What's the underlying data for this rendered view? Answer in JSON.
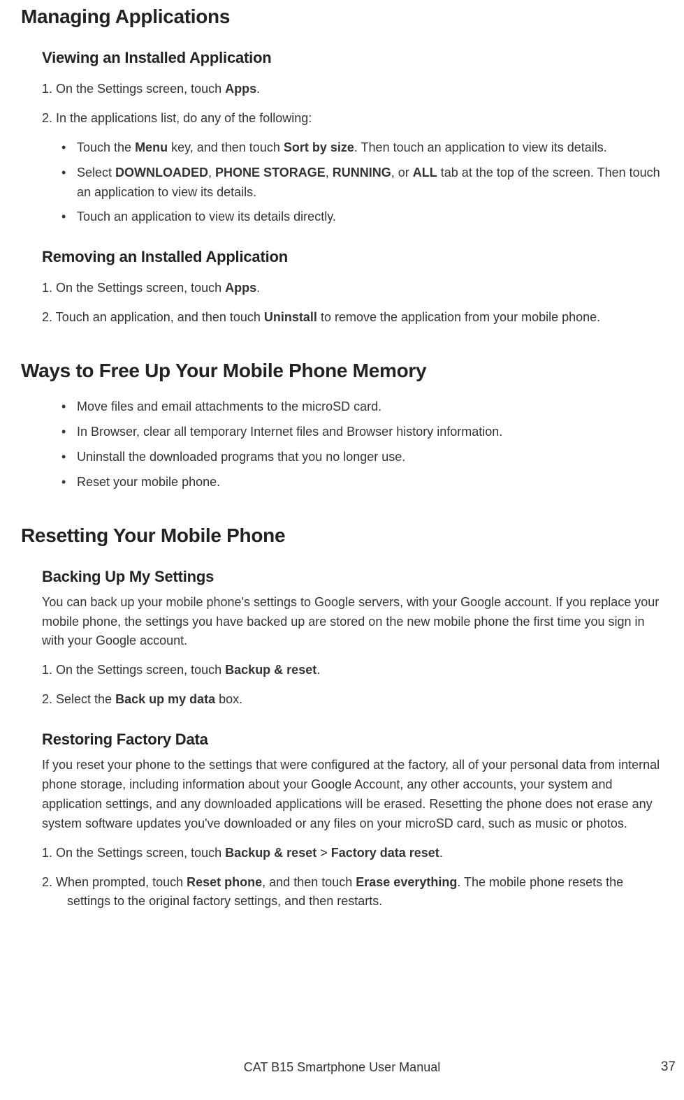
{
  "h1_managing": "Managing Applications",
  "section_viewing": {
    "heading": "Viewing an Installed Application",
    "step1_a": "1. On the Settings screen, touch ",
    "step1_b": "Apps",
    "step1_c": ".",
    "step2": "2. In the applications list, do any of the following:",
    "bullets": [
      {
        "a": "Touch the ",
        "b1": "Menu",
        "c": " key, and then touch ",
        "b2": "Sort by size",
        "d": ". Then touch an application to view its details."
      },
      {
        "a": "Select ",
        "b1": "DOWNLOADED",
        "c": ", ",
        "b2": "PHONE STORAGE",
        "d": ", ",
        "b3": "RUNNING",
        "e": ", or ",
        "b4": "ALL",
        "f": " tab at the top of the screen. Then touch an application to view its details."
      },
      {
        "a": "Touch an application to view its details directly."
      }
    ]
  },
  "section_removing": {
    "heading": "Removing an Installed Application",
    "step1_a": "1. On the Settings screen, touch ",
    "step1_b": "Apps",
    "step1_c": ".",
    "step2_a": "2. Touch an application, and then touch ",
    "step2_b": "Uninstall",
    "step2_c": " to remove the application from your mobile phone."
  },
  "h1_ways": "Ways to Free Up Your Mobile Phone Memory",
  "ways_bullets": [
    "Move files and email attachments to the microSD card.",
    "In Browser, clear all temporary Internet files and Browser history information.",
    "Uninstall the downloaded programs that you no longer use.",
    "Reset your mobile phone."
  ],
  "h1_reset": "Resetting Your Mobile Phone",
  "section_backup": {
    "heading": "Backing Up My Settings",
    "para": "You can back up your mobile phone's settings to Google servers, with your Google account. If you replace your mobile phone, the settings you have backed up are stored on the new mobile phone the first time you sign in with your Google account.",
    "step1_a": "1. On the Settings screen, touch ",
    "step1_b": "Backup & reset",
    "step1_c": ".",
    "step2_a": "2. Select the ",
    "step2_b": "Back up my data",
    "step2_c": " box."
  },
  "section_restore": {
    "heading": "Restoring Factory Data",
    "para": "If you reset your phone to the settings that were configured at the factory, all of your personal data from internal phone storage, including information about your Google Account, any other accounts, your system and application settings, and any downloaded applications will be erased. Resetting the phone does not erase any system software updates you've downloaded or any files on your microSD card, such as music or photos.",
    "step1_a": "1. On the Settings screen, touch ",
    "step1_b": "Backup & reset",
    "step1_c": " > ",
    "step1_d": "Factory data reset",
    "step1_e": ".",
    "step2_a": "2. When prompted, touch ",
    "step2_b": "Reset phone",
    "step2_c": ", and then touch ",
    "step2_d": "Erase everything",
    "step2_e": ". The mobile phone resets the settings to the original factory settings, and then restarts."
  },
  "footer": "CAT B15 Smartphone User Manual",
  "page_number": "37"
}
